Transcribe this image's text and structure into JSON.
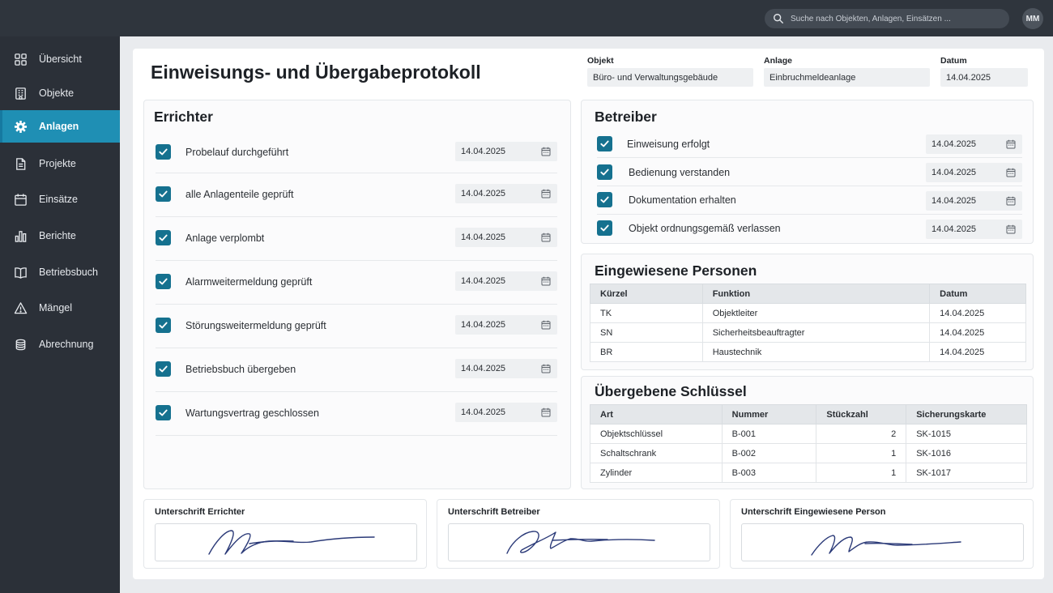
{
  "topbar": {
    "search_placeholder": "Suche nach Objekten, Anlagen, Einsätzen ...",
    "avatar_initials": "MM"
  },
  "sidebar": {
    "items": [
      {
        "label": "Übersicht",
        "icon": "grid-icon",
        "active": false
      },
      {
        "label": "Objekte",
        "icon": "building-icon",
        "active": false
      },
      {
        "label": "Anlagen",
        "icon": "gear-icon",
        "active": true
      },
      {
        "label": "Projekte",
        "icon": "document-icon",
        "active": false
      },
      {
        "label": "Einsätze",
        "icon": "calendar-icon",
        "active": false
      },
      {
        "label": "Berichte",
        "icon": "bar-chart-icon",
        "active": false
      },
      {
        "label": "Betriebsbuch",
        "icon": "book-icon",
        "active": false
      },
      {
        "label": "Mängel",
        "icon": "warning-icon",
        "active": false
      },
      {
        "label": "Abrechnung",
        "icon": "coins-icon",
        "active": false
      }
    ]
  },
  "header": {
    "title": "Einweisungs- und Übergabeprotokoll",
    "objekt_label": "Objekt",
    "objekt_value": "Büro- und Verwaltungsgebäude",
    "anlage_label": "Anlage",
    "anlage_value": "Einbruchmeldeanlage",
    "datum_label": "Datum",
    "datum_value": "14.04.2025"
  },
  "errichter": {
    "title": "Errichter",
    "items": [
      {
        "label": "Probelauf durchgeführt",
        "date": "14.04.2025",
        "checked": true
      },
      {
        "label": "alle Anlagenteile geprüft",
        "date": "14.04.2025",
        "checked": true
      },
      {
        "label": "Anlage verplombt",
        "date": "14.04.2025",
        "checked": true
      },
      {
        "label": "Alarmweitermeldung geprüft",
        "date": "14.04.2025",
        "checked": true
      },
      {
        "label": "Störungsweitermeldung geprüft",
        "date": "14.04.2025",
        "checked": true
      },
      {
        "label": "Betriebsbuch übergeben",
        "date": "14.04.2025",
        "checked": true
      },
      {
        "label": "Wartungsvertrag geschlossen",
        "date": "14.04.2025",
        "checked": true
      }
    ]
  },
  "betreiber": {
    "title": "Betreiber",
    "items": [
      {
        "label": "Einweisung erfolgt",
        "date": "14.04.2025",
        "checked": true
      },
      {
        "label": "Bedienung verstanden",
        "date": "14.04.2025",
        "checked": true
      },
      {
        "label": "Dokumentation erhalten",
        "date": "14.04.2025",
        "checked": true
      },
      {
        "label": "Objekt ordnungsgemäß verlassen",
        "date": "14.04.2025",
        "checked": true
      }
    ]
  },
  "personen": {
    "title": "Eingewiesene Personen",
    "columns": [
      "Kürzel",
      "Funktion",
      "Datum"
    ],
    "rows": [
      [
        "TK",
        "Objektleiter",
        "14.04.2025"
      ],
      [
        "SN",
        "Sicherheitsbeauftragter",
        "14.04.2025"
      ],
      [
        "BR",
        "Haustechnik",
        "14.04.2025"
      ]
    ]
  },
  "schluessel": {
    "title": "Übergebene Schlüssel",
    "columns": [
      "Art",
      "Nummer",
      "Stückzahl",
      "Sicherungskarte"
    ],
    "rows": [
      [
        "Objektschlüssel",
        "B-001",
        "2",
        "SK-1015"
      ],
      [
        "Schaltschrank",
        "B-002",
        "1",
        "SK-1016"
      ],
      [
        "Zylinder",
        "B-003",
        "1",
        "SK-1017"
      ]
    ]
  },
  "signatures": [
    {
      "label": "Unterschrift Errichter"
    },
    {
      "label": "Unterschrift Betreiber"
    },
    {
      "label": "Unterschrift Eingewiesene Person"
    }
  ],
  "colors": {
    "accent": "#1f8fb4",
    "checkbox": "#15718f",
    "sidebar_bg": "#2b3038",
    "topbar_bg": "#2f353d",
    "signature_ink": "#2b3a78"
  }
}
